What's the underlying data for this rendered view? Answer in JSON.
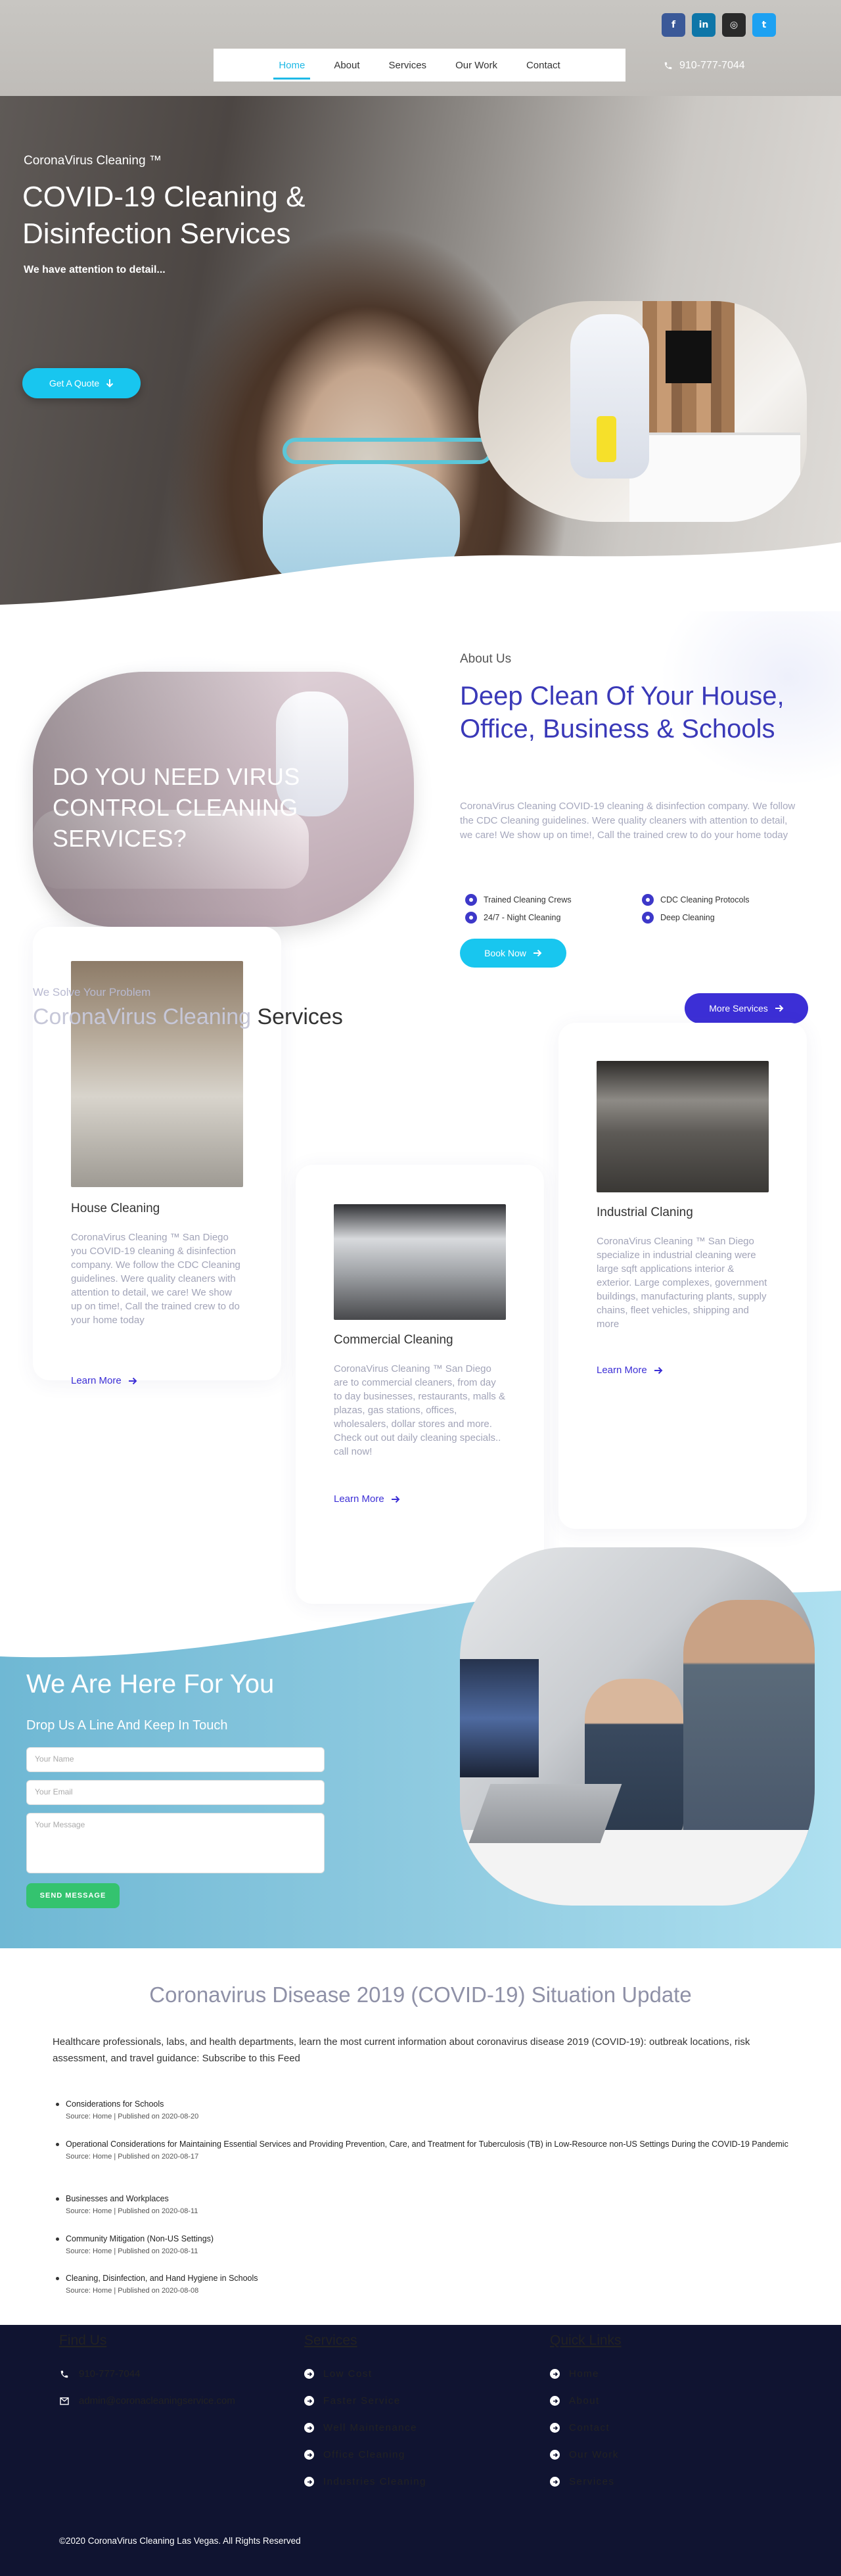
{
  "social": [
    {
      "icon": "facebook-icon",
      "glyph": "f",
      "color": "#3b5998"
    },
    {
      "icon": "linkedin-icon",
      "glyph": "in",
      "color": "#0e76a8"
    },
    {
      "icon": "instagram-icon",
      "glyph": "◎",
      "color": "#2a2a2a"
    },
    {
      "icon": "twitter-icon",
      "glyph": "t",
      "color": "#1da1f2"
    }
  ],
  "nav": {
    "items": [
      "Home",
      "About",
      "Services",
      "Our Work",
      "Contact"
    ],
    "active": "Home",
    "phone": "910-777-7044"
  },
  "hero": {
    "subtitle": "CoronaVirus Cleaning ™",
    "title": "COVID-19 Cleaning & Disinfection Services",
    "tagline": "We have attention to detail...",
    "cta": "Get A Quote"
  },
  "about": {
    "image_text": "DO YOU NEED VIRUS CONTROL CLEANING SERVICES?",
    "kicker": "About Us",
    "title": "Deep Clean Of Your House, Office, Business & Schools",
    "text": "CoronaVirus Cleaning COVID-19 cleaning & disinfection company. We follow the CDC Cleaning guidelines. Were quality cleaners with attention to detail, we care! We show up on time!, Call the trained crew to do your home today",
    "features": [
      "Trained Cleaning Crews",
      "CDC Cleaning Protocols",
      "24/7 - Night Cleaning",
      "Deep Cleaning"
    ],
    "button": "Book Now"
  },
  "services": {
    "kicker": "We Solve Your Problem",
    "title_faded": "CoronaVirus Cleaning",
    "title_rest": " Services",
    "more_button": "More Services",
    "learn_more": "Learn More",
    "cards": [
      {
        "title": "House Cleaning",
        "text": "CoronaVirus Cleaning ™ San Diego you COVID-19 cleaning & disinfection company. We follow the CDC Cleaning guidelines. Were quality cleaners with attention to detail, we care! We show up on time!, Call the trained crew to do your home today"
      },
      {
        "title": "Commercial Cleaning",
        "text": "CoronaVirus Cleaning ™ San Diego are to commercial cleaners, from day to day businesses, restaurants, malls & plazas, gas stations, offices, wholesalers, dollar stores and more. Check out out daily cleaning specials.. call now!"
      },
      {
        "title": "Industrial Claning",
        "text": "CoronaVirus Cleaning ™ San Diego specialize in industrial cleaning were large sqft applications interior & exterior. Large complexes, government buildings, manufacturing plants, supply chains, fleet vehicles, shipping and more"
      }
    ]
  },
  "contact": {
    "title": "We Are Here For You",
    "subtitle": "Drop Us A Line And Keep In Touch",
    "name_placeholder": "Your Name",
    "email_placeholder": "Your Email",
    "message_placeholder": "Your Message",
    "send": "SEND MESSAGE"
  },
  "covid": {
    "title": "Coronavirus Disease 2019 (COVID-19) Situation Update",
    "intro": "Healthcare professionals, labs, and health departments, learn the most current information about coronavirus disease 2019 (COVID-19): outbreak locations, risk assessment, and travel guidance: Subscribe to this Feed",
    "items": [
      {
        "title": "Considerations for Schools",
        "source": "Source: Home | Published on 2020-08-20"
      },
      {
        "title": "Operational Considerations for Maintaining Essential Services and Providing Prevention, Care, and Treatment for Tuberculosis (TB) in Low-Resource non-US Settings During the COVID-19 Pandemic",
        "source": "Source: Home | Published on 2020-08-17"
      },
      {
        "title": "Businesses and Workplaces",
        "source": "Source: Home | Published on 2020-08-11"
      },
      {
        "title": "Community Mitigation (Non-US Settings)",
        "source": "Source: Home | Published on 2020-08-11"
      },
      {
        "title": "Cleaning, Disinfection, and Hand Hygiene in Schools",
        "source": "Source: Home | Published on 2020-08-08"
      }
    ]
  },
  "footer": {
    "find_us": {
      "heading": "Find Us",
      "phone": "910-777-7044",
      "email": "admin@coronacleaningservice.com"
    },
    "services": {
      "heading": "Services",
      "items": [
        "Low Cost",
        "Faster Service",
        "Well Maintenance",
        "Office Cleaning",
        "Industries Cleaning"
      ]
    },
    "quick_links": {
      "heading": "Quick Links",
      "items": [
        "Home",
        "About",
        "Contact",
        "Our Work",
        "Services"
      ]
    },
    "copyright": "©2020 CoronaVirus Cleaning Las Vegas. All Rights Reserved"
  },
  "colors": {
    "accent": "#18c6ef",
    "primary": "#3c2fd6",
    "title_blue": "#3a39b8",
    "footer_bg": "#101431",
    "send_green": "#34c36f"
  }
}
